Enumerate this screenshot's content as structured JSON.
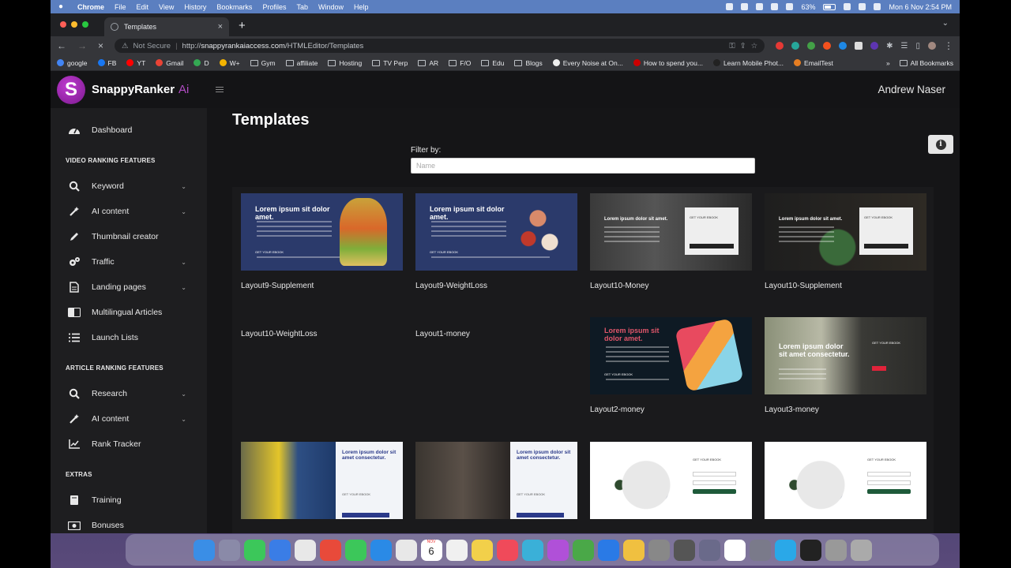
{
  "menubar": {
    "app": "Chrome",
    "items": [
      "File",
      "Edit",
      "View",
      "History",
      "Bookmarks",
      "Profiles",
      "Tab",
      "Window",
      "Help"
    ],
    "battery": "63%",
    "datetime": "Mon 6 Nov  2:54 PM"
  },
  "browser": {
    "tab_title": "Templates",
    "security": "Not Secure",
    "url_prefix": "http://",
    "url_domain": "snappyrankaiaccess.com",
    "url_path": "/HTMLEditor/Templates",
    "bookmarks": [
      {
        "label": "google",
        "type": "site",
        "color": "#4285f4"
      },
      {
        "label": "FB",
        "type": "site",
        "color": "#1877f2"
      },
      {
        "label": "YT",
        "type": "site",
        "color": "#ff0000"
      },
      {
        "label": "Gmail",
        "type": "site",
        "color": "#ea4335"
      },
      {
        "label": "D",
        "type": "site",
        "color": "#34a853"
      },
      {
        "label": "W+",
        "type": "site",
        "color": "#f4b400"
      },
      {
        "label": "Gym",
        "type": "folder"
      },
      {
        "label": "affiliate",
        "type": "folder"
      },
      {
        "label": "Hosting",
        "type": "folder"
      },
      {
        "label": "TV Perp",
        "type": "folder"
      },
      {
        "label": "AR",
        "type": "folder"
      },
      {
        "label": "F/O",
        "type": "folder"
      },
      {
        "label": "Edu",
        "type": "folder"
      },
      {
        "label": "Blogs",
        "type": "folder"
      },
      {
        "label": "Every Noise at On...",
        "type": "site",
        "color": "#eeeeee"
      },
      {
        "label": "How to spend you...",
        "type": "site",
        "color": "#cc0000"
      },
      {
        "label": "Learn Mobile Phot...",
        "type": "site",
        "color": "#222222"
      },
      {
        "label": "EmailTest",
        "type": "site",
        "color": "#e67e22"
      }
    ],
    "more": "»",
    "all_bookmarks": "All Bookmarks"
  },
  "app": {
    "brand": "SnappyRanker",
    "brand_suffix": "Ai",
    "logo_letter": "S",
    "user": "Andrew Naser"
  },
  "sidebar": {
    "dashboard": "Dashboard",
    "section_video": "VIDEO RANKING FEATURES",
    "video_items": [
      {
        "label": "Keyword",
        "icon": "search-icon",
        "expandable": true
      },
      {
        "label": "AI content",
        "icon": "magic-wand-icon",
        "expandable": true
      },
      {
        "label": "Thumbnail creator",
        "icon": "pencil-icon",
        "expandable": false
      },
      {
        "label": "Traffic",
        "icon": "gears-icon",
        "expandable": true
      },
      {
        "label": "Landing pages",
        "icon": "file-icon",
        "expandable": true
      },
      {
        "label": "Multilingual Articles",
        "icon": "translate-icon",
        "expandable": false
      },
      {
        "label": "Launch Lists",
        "icon": "list-icon",
        "expandable": false
      }
    ],
    "section_article": "ARTICLE RANKING FEATURES",
    "article_items": [
      {
        "label": "Research",
        "icon": "search-icon",
        "expandable": true
      },
      {
        "label": "AI content",
        "icon": "magic-wand-icon",
        "expandable": true
      },
      {
        "label": "Rank Tracker",
        "icon": "chart-line-icon",
        "expandable": false
      }
    ],
    "section_extras": "EXTRAS",
    "extras_items": [
      {
        "label": "Training",
        "icon": "book-icon"
      },
      {
        "label": "Bonuses",
        "icon": "money-icon"
      }
    ]
  },
  "main": {
    "title": "Templates",
    "filter_label": "Filter by:",
    "filter_placeholder": "Name",
    "filter_value": ""
  },
  "templates": [
    {
      "name": "Layout9-Supplement",
      "headline": "Lorem ipsum sit dolor amet.",
      "cta": "GET YOUR EBOOK",
      "style": "navy"
    },
    {
      "name": "Layout9-WeightLoss",
      "headline": "Lorem ipsum sit dolor amet.",
      "cta": "GET YOUR EBOOK",
      "style": "navy"
    },
    {
      "name": "Layout10-Money",
      "headline": "Lorem ipsum dolor sit amet.",
      "cta": "GET YOUR EBOOK",
      "style": "dark"
    },
    {
      "name": "Layout10-Supplement",
      "headline": "Lorem ipsum dolor sit amet.",
      "cta": "GET YOUR EBOOK",
      "style": "dark"
    },
    {
      "name": "Layout10-WeightLoss",
      "style": "none"
    },
    {
      "name": "Layout1-money",
      "style": "none"
    },
    {
      "name": "Layout2-money",
      "headline": "Lorem ipsum sit dolor amet.",
      "cta": "GET YOUR EBOOK",
      "style": "teal"
    },
    {
      "name": "Layout3-money",
      "headline": "Lorem ipsum dolor sit amet consectetur.",
      "cta": "GET YOUR EBOOK",
      "style": "photo"
    },
    {
      "name": "",
      "headline": "Lorem ipsum dolor sit amet consectetur.",
      "cta": "GET YOUR EBOOK",
      "style": "split"
    },
    {
      "name": "",
      "headline": "Lorem ipsum dolor sit amet consectetur.",
      "cta": "GET YOUR EBOOK",
      "style": "split"
    },
    {
      "name": "",
      "headline": "",
      "cta": "GET YOUR EBOOK",
      "style": "white"
    },
    {
      "name": "",
      "headline": "",
      "cta": "GET YOUR EBOOK",
      "style": "white"
    }
  ],
  "dock": {
    "calendar_day": "6",
    "calendar_month": "NOV"
  }
}
